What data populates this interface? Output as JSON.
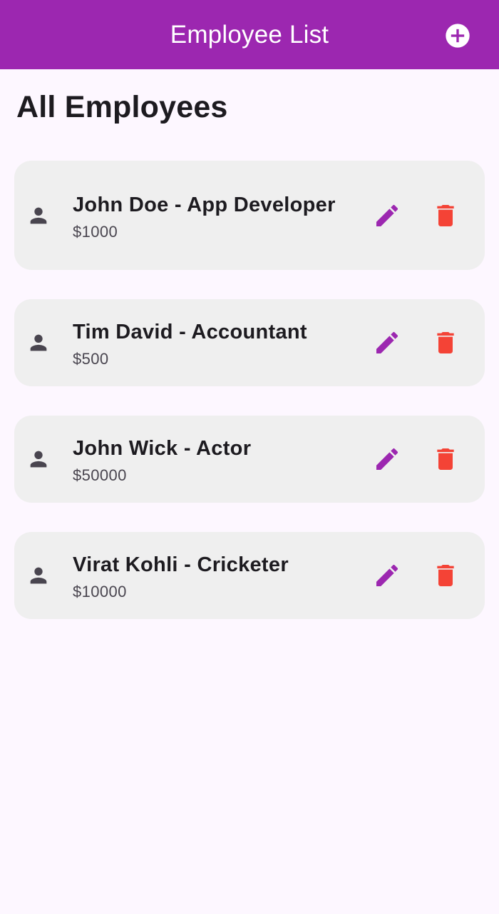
{
  "app_bar": {
    "title": "Employee List",
    "add_icon": "add-circle-icon",
    "background_color": "#9c27b0"
  },
  "section": {
    "title": "All Employees"
  },
  "employees": [
    {
      "title": "John Doe - App Developer",
      "salary": "$1000"
    },
    {
      "title": "Tim David - Accountant",
      "salary": "$500"
    },
    {
      "title": "John Wick - Actor",
      "salary": "$50000"
    },
    {
      "title": "Virat Kohli - Cricketer",
      "salary": "$10000"
    }
  ],
  "icons": {
    "person": "person-icon",
    "edit": "pencil-icon",
    "delete": "trash-icon"
  },
  "colors": {
    "accent": "#9c27b0",
    "edit_icon": "#9c27b0",
    "delete_icon": "#f44336",
    "person_icon": "#49454f",
    "card_background": "#efefef",
    "page_background": "#fdf7ff"
  }
}
